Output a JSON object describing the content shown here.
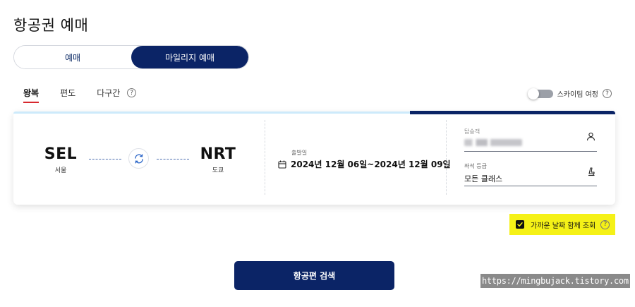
{
  "page": {
    "title": "항공권 예매"
  },
  "mode_toggle": {
    "options": [
      "예매",
      "마일리지 예매"
    ],
    "selected": "마일리지 예매"
  },
  "trip_tabs": {
    "items": [
      "왕복",
      "편도",
      "다구간"
    ],
    "selected": "왕복",
    "help_icon": "question-circle-icon"
  },
  "skyteam": {
    "label": "스카이팀 여정",
    "enabled": false
  },
  "route": {
    "departure": {
      "code": "SEL",
      "city": "서울"
    },
    "arrival": {
      "code": "NRT",
      "city": "도쿄"
    },
    "swap_icon": "swap-arrows-icon"
  },
  "dates": {
    "label": "출발일",
    "value": "2024년 12월 06일~2024년 12월 09일",
    "icon": "calendar-icon"
  },
  "passengers": {
    "label": "탑승객",
    "icon": "person-icon"
  },
  "seat_class": {
    "label": "좌석 등급",
    "value": "모든 클래스",
    "icon": "seat-icon"
  },
  "nearby_dates": {
    "label": "가까운 날짜 함께 조회",
    "checked": true
  },
  "search_button": {
    "label": "항공편 검색"
  },
  "watermark": {
    "text": "https://mingbujack.tistory.com"
  },
  "colors": {
    "navy": "#0b2466",
    "highlight": "#f5f117",
    "tab_underline": "#d7282e",
    "card_accent_light": "#cdeafb"
  }
}
